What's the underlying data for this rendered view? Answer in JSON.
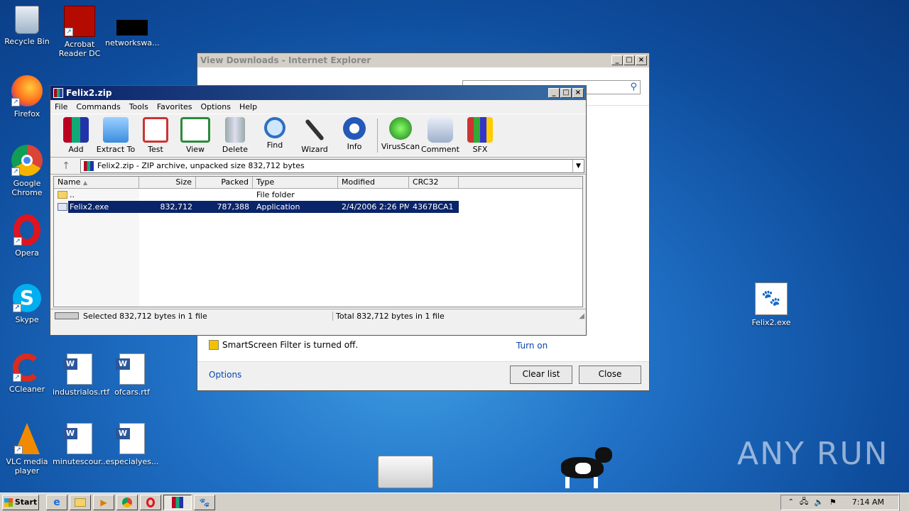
{
  "desktop_icons": [
    {
      "label": "Recycle Bin"
    },
    {
      "label": "Acrobat Reader DC"
    },
    {
      "label": "networkswa..."
    },
    {
      "label": "Firefox"
    },
    {
      "label": "Google Chrome"
    },
    {
      "label": "Opera"
    },
    {
      "label": "Skype"
    },
    {
      "label": "CCleaner"
    },
    {
      "label": "industrialos.rtf"
    },
    {
      "label": "ofcars.rtf"
    },
    {
      "label": "VLC media player"
    },
    {
      "label": "minutescour..."
    },
    {
      "label": "especialyes..."
    },
    {
      "label": "Felix2.exe"
    }
  ],
  "ie_window": {
    "title": "View Downloads - Internet Explorer",
    "smartscreen_text": "SmartScreen Filter is turned off.",
    "turn_on_link": "Turn on",
    "options_link": "Options",
    "clear_list_button": "Clear list",
    "close_button": "Close"
  },
  "winrar": {
    "title": "Felix2.zip",
    "menu": [
      "File",
      "Commands",
      "Tools",
      "Favorites",
      "Options",
      "Help"
    ],
    "tools": [
      {
        "label": "Add",
        "icon": "add-archive-icon"
      },
      {
        "label": "Extract To",
        "icon": "extract-folder-icon"
      },
      {
        "label": "Test",
        "icon": "test-clipboard-icon"
      },
      {
        "label": "View",
        "icon": "view-book-icon"
      },
      {
        "label": "Delete",
        "icon": "trash-icon"
      },
      {
        "label": "Find",
        "icon": "magnifier-icon"
      },
      {
        "label": "Wizard",
        "icon": "wand-icon"
      },
      {
        "label": "Info",
        "icon": "info-icon"
      },
      {
        "label": "VirusScan",
        "icon": "virus-icon"
      },
      {
        "label": "Comment",
        "icon": "comment-icon"
      },
      {
        "label": "SFX",
        "icon": "sfx-box-icon"
      }
    ],
    "path": "Felix2.zip - ZIP archive, unpacked size 832,712 bytes",
    "columns": [
      "Name",
      "Size",
      "Packed",
      "Type",
      "Modified",
      "CRC32"
    ],
    "rows": [
      {
        "name": "..",
        "size": "",
        "packed": "",
        "type": "File folder",
        "modified": "",
        "crc": ""
      },
      {
        "name": "Felix2.exe",
        "size": "832,712",
        "packed": "787,388",
        "type": "Application",
        "modified": "2/4/2006 2:26 PM",
        "crc": "4367BCA1"
      }
    ],
    "status_left": "Selected 832,712 bytes in 1 file",
    "status_right": "Total 832,712 bytes in 1 file"
  },
  "taskbar": {
    "start_label": "Start",
    "clock": "7:14 AM"
  },
  "watermark": "ANY RUN",
  "colors": {
    "selection": "#0a246a",
    "title_active": "#0a246a"
  }
}
